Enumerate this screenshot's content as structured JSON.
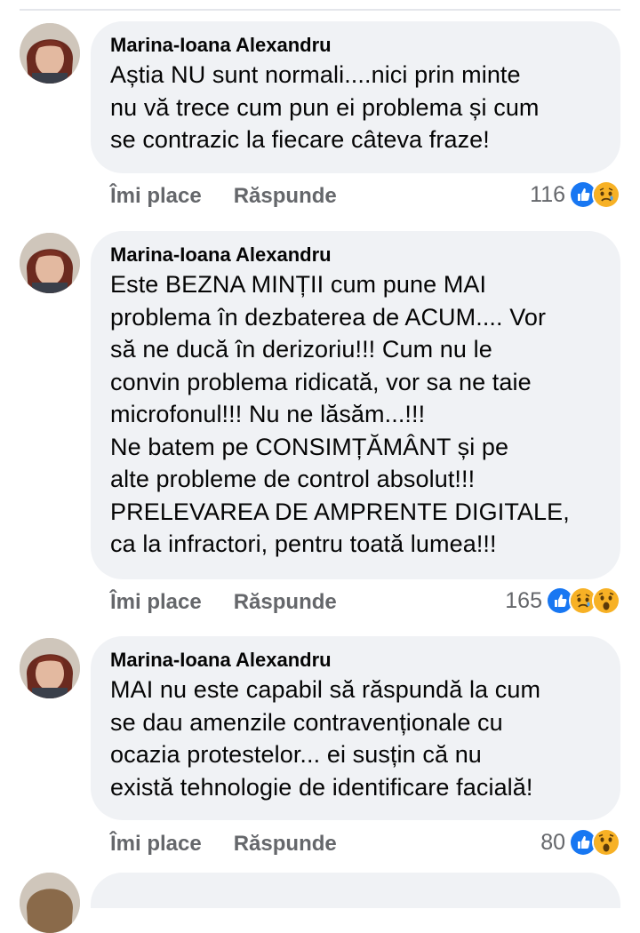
{
  "comments": [
    {
      "author": "Marina-Ioana Alexandru",
      "text": "Aștia NU sunt normali....nici prin minte\nnu vă trece cum pun ei problema și cum\nse contrazic la fiecare câteva fraze!",
      "like_label": "Îmi place",
      "reply_label": "Răspunde",
      "reaction_count": "116",
      "reactions": [
        "like-icon",
        "sad-icon"
      ]
    },
    {
      "author": "Marina-Ioana Alexandru",
      "text": "Este BEZNA MINȚII cum pune MAI\nproblema în dezbaterea de ACUM.... Vor\nsă ne ducă în derizoriu!!! Cum nu le\nconvin problema ridicată, vor sa ne taie\nmicrofonul!!! Nu ne lăsăm...!!!\nNe batem pe CONSIMȚĂMÂNT și pe\nalte probleme de control absolut!!!\nPRELEVAREA DE AMPRENTE DIGITALE,\nca la infractori, pentru toată lumea!!!",
      "like_label": "Îmi place",
      "reply_label": "Răspunde",
      "reaction_count": "165",
      "reactions": [
        "like-icon",
        "sad-icon",
        "wow-icon"
      ]
    },
    {
      "author": "Marina-Ioana Alexandru",
      "text": "MAI nu este capabil să răspundă la cum\nse dau amenzile contravenționale cu\nocazia protestelor... ei susțin că nu\nexistă tehnologie de identificare facială!",
      "like_label": "Îmi place",
      "reply_label": "Răspunde",
      "reaction_count": "80",
      "reactions": [
        "like-icon",
        "wow-icon"
      ]
    }
  ],
  "colors": {
    "bubble": "#f0f2f5",
    "secondary_text": "#65676b",
    "like_blue": "#1877f2",
    "emoji_yellow": "#f7b125"
  }
}
